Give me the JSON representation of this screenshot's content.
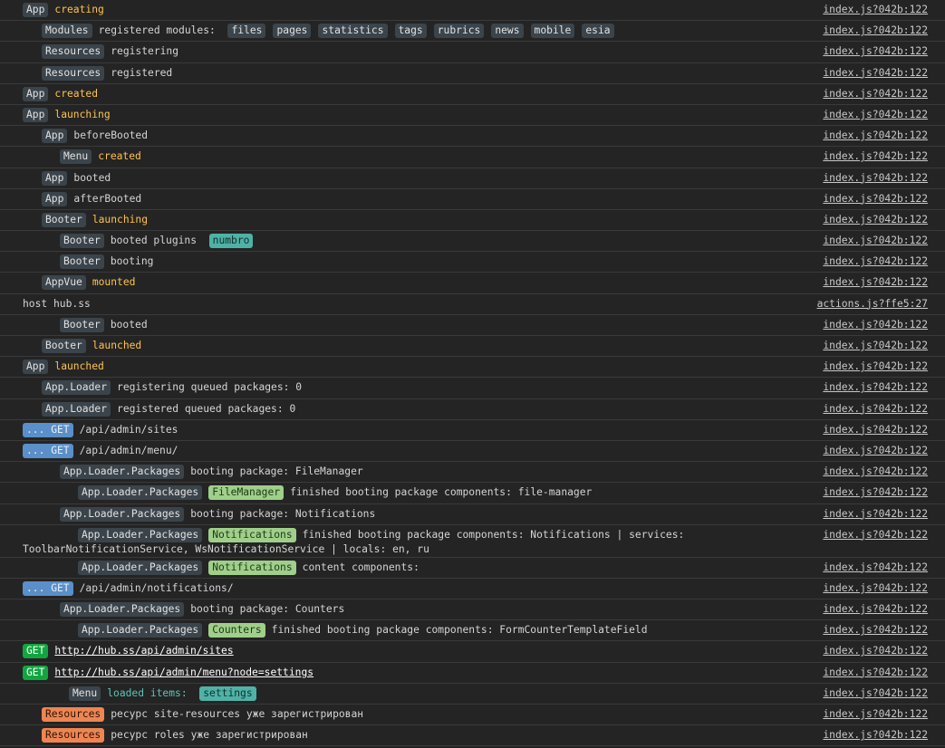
{
  "console": {
    "rows": [
      {
        "indent": 25,
        "tags": [
          {
            "text": "App",
            "style": "dark"
          }
        ],
        "text": "creating",
        "text_style": "yellow",
        "source": "index.js?042b:122"
      },
      {
        "indent": 46,
        "tags": [
          {
            "text": "Modules",
            "style": "dark"
          }
        ],
        "text": "registered modules:",
        "text_style": "plain",
        "chips": [
          "files",
          "pages",
          "statistics",
          "tags",
          "rubrics",
          "news",
          "mobile",
          "esia"
        ],
        "source": "index.js?042b:122"
      },
      {
        "indent": 46,
        "tags": [
          {
            "text": "Resources",
            "style": "dark"
          }
        ],
        "text": "registering",
        "text_style": "plain",
        "source": "index.js?042b:122"
      },
      {
        "indent": 46,
        "tags": [
          {
            "text": "Resources",
            "style": "dark"
          }
        ],
        "text": "registered",
        "text_style": "plain",
        "source": "index.js?042b:122"
      },
      {
        "indent": 25,
        "tags": [
          {
            "text": "App",
            "style": "dark"
          }
        ],
        "text": "created",
        "text_style": "yellow",
        "source": "index.js?042b:122"
      },
      {
        "indent": 25,
        "tags": [
          {
            "text": "App",
            "style": "dark"
          }
        ],
        "text": "launching",
        "text_style": "yellow",
        "source": "index.js?042b:122"
      },
      {
        "indent": 46,
        "tags": [
          {
            "text": "App",
            "style": "dark"
          }
        ],
        "text": "beforeBooted",
        "text_style": "plain",
        "source": "index.js?042b:122"
      },
      {
        "indent": 66,
        "tags": [
          {
            "text": "Menu",
            "style": "dark"
          }
        ],
        "text": "created",
        "text_style": "yellow",
        "source": "index.js?042b:122"
      },
      {
        "indent": 46,
        "tags": [
          {
            "text": "App",
            "style": "dark"
          }
        ],
        "text": "booted",
        "text_style": "plain",
        "source": "index.js?042b:122"
      },
      {
        "indent": 46,
        "tags": [
          {
            "text": "App",
            "style": "dark"
          }
        ],
        "text": "afterBooted",
        "text_style": "plain",
        "source": "index.js?042b:122"
      },
      {
        "indent": 46,
        "tags": [
          {
            "text": "Booter",
            "style": "dark"
          }
        ],
        "text": "launching",
        "text_style": "yellow",
        "source": "index.js?042b:122"
      },
      {
        "indent": 66,
        "tags": [
          {
            "text": "Booter",
            "style": "dark"
          }
        ],
        "text": "booted plugins",
        "text_style": "plain",
        "post_tags": [
          {
            "text": "numbro",
            "style": "teal"
          }
        ],
        "source": "index.js?042b:122"
      },
      {
        "indent": 66,
        "tags": [
          {
            "text": "Booter",
            "style": "dark"
          }
        ],
        "text": "booting",
        "text_style": "plain",
        "source": "index.js?042b:122"
      },
      {
        "indent": 46,
        "tags": [
          {
            "text": "AppVue",
            "style": "dark"
          }
        ],
        "text": "mounted",
        "text_style": "yellow",
        "source": "index.js?042b:122"
      },
      {
        "indent": 25,
        "tags": [],
        "text": "host hub.ss",
        "text_style": "plain",
        "source": "actions.js?ffe5:27"
      },
      {
        "indent": 66,
        "tags": [
          {
            "text": "Booter",
            "style": "dark"
          }
        ],
        "text": "booted",
        "text_style": "plain",
        "source": "index.js?042b:122"
      },
      {
        "indent": 46,
        "tags": [
          {
            "text": "Booter",
            "style": "dark"
          }
        ],
        "text": "launched",
        "text_style": "yellow",
        "source": "index.js?042b:122"
      },
      {
        "indent": 25,
        "tags": [
          {
            "text": "App",
            "style": "dark"
          }
        ],
        "text": "launched",
        "text_style": "yellow",
        "source": "index.js?042b:122"
      },
      {
        "indent": 46,
        "tags": [
          {
            "text": "App.Loader",
            "style": "dark"
          }
        ],
        "text": "registering queued packages: 0",
        "text_style": "plain",
        "source": "index.js?042b:122"
      },
      {
        "indent": 46,
        "tags": [
          {
            "text": "App.Loader",
            "style": "dark"
          }
        ],
        "text": "registered queued packages: 0",
        "text_style": "plain",
        "source": "index.js?042b:122"
      },
      {
        "indent": 25,
        "tags": [
          {
            "text": "... GET",
            "style": "getpend"
          }
        ],
        "text": "/api/admin/sites",
        "text_style": "plain",
        "source": "index.js?042b:122"
      },
      {
        "indent": 25,
        "tags": [
          {
            "text": "... GET",
            "style": "getpend"
          }
        ],
        "text": "/api/admin/menu/",
        "text_style": "plain",
        "source": "index.js?042b:122"
      },
      {
        "indent": 66,
        "tags": [
          {
            "text": "App.Loader.Packages",
            "style": "dark"
          }
        ],
        "text": "booting package: FileManager",
        "text_style": "plain",
        "source": "index.js?042b:122"
      },
      {
        "indent": 86,
        "tags": [
          {
            "text": "App.Loader.Packages",
            "style": "dark"
          },
          {
            "text": "FileManager",
            "style": "green"
          }
        ],
        "text": "finished booting package components: file-manager",
        "text_style": "plain",
        "source": "index.js?042b:122"
      },
      {
        "indent": 66,
        "tags": [
          {
            "text": "App.Loader.Packages",
            "style": "dark"
          }
        ],
        "text": "booting package: Notifications",
        "text_style": "plain",
        "source": "index.js?042b:122"
      },
      {
        "indent": 86,
        "tags": [
          {
            "text": "App.Loader.Packages",
            "style": "dark"
          },
          {
            "text": "Notifications",
            "style": "green"
          }
        ],
        "text": "finished booting package components: Notifications | services:",
        "text_style": "plain",
        "continuation": "ToolbarNotificationService, WsNotificationService | locals: en, ru",
        "source": "index.js?042b:122"
      },
      {
        "indent": 86,
        "tags": [
          {
            "text": "App.Loader.Packages",
            "style": "dark"
          },
          {
            "text": "Notifications",
            "style": "green"
          }
        ],
        "text": "content components:",
        "text_style": "plain",
        "source": "index.js?042b:122"
      },
      {
        "indent": 25,
        "tags": [
          {
            "text": "... GET",
            "style": "getpend"
          }
        ],
        "text": "/api/admin/notifications/",
        "text_style": "plain",
        "source": "index.js?042b:122"
      },
      {
        "indent": 66,
        "tags": [
          {
            "text": "App.Loader.Packages",
            "style": "dark"
          }
        ],
        "text": "booting package: Counters",
        "text_style": "plain",
        "source": "index.js?042b:122"
      },
      {
        "indent": 86,
        "tags": [
          {
            "text": "App.Loader.Packages",
            "style": "dark"
          },
          {
            "text": "Counters",
            "style": "green"
          }
        ],
        "text": "finished booting package components: FormCounterTemplateField",
        "text_style": "plain",
        "source": "index.js?042b:122"
      },
      {
        "indent": 25,
        "tags": [
          {
            "text": "GET",
            "style": "getok"
          }
        ],
        "text": "http://hub.ss/api/admin/sites",
        "text_style": "link",
        "source": "index.js?042b:122"
      },
      {
        "indent": 25,
        "tags": [
          {
            "text": "GET",
            "style": "getok"
          }
        ],
        "text": "http://hub.ss/api/admin/menu?node=settings",
        "text_style": "link",
        "source": "index.js?042b:122"
      },
      {
        "indent": 76,
        "tags": [
          {
            "text": "Menu",
            "style": "dark"
          }
        ],
        "text": "loaded items:",
        "text_style": "cyan",
        "post_tags": [
          {
            "text": "settings",
            "style": "teal"
          }
        ],
        "source": "index.js?042b:122"
      },
      {
        "indent": 46,
        "tags": [
          {
            "text": "Resources",
            "style": "orange"
          }
        ],
        "text": "ресурс site-resources уже зарегистрирован",
        "text_style": "plain",
        "source": "index.js?042b:122"
      },
      {
        "indent": 46,
        "tags": [
          {
            "text": "Resources",
            "style": "orange"
          }
        ],
        "text": "ресурс roles уже зарегистрирован",
        "text_style": "plain",
        "source": "index.js?042b:122"
      }
    ]
  }
}
